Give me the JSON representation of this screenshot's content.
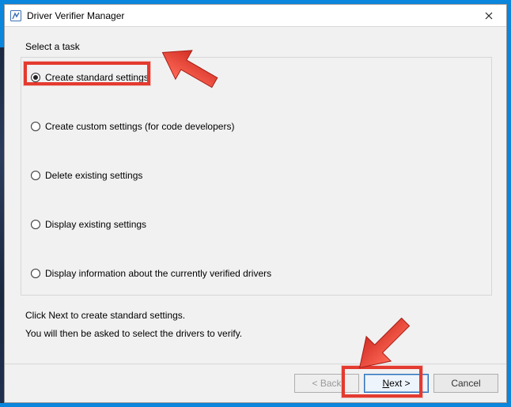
{
  "window": {
    "title": "Driver Verifier Manager",
    "icon_name": "verifier-icon"
  },
  "task_label": "Select a task",
  "options": {
    "opt0": "Create standard settings",
    "opt1": "Create custom settings (for code developers)",
    "opt2": "Delete existing settings",
    "opt3": "Display existing settings",
    "opt4": "Display information about the currently verified drivers"
  },
  "selected_option": 0,
  "hint_line1": "Click Next to create standard settings.",
  "hint_line2": "You will then be asked to select the drivers to verify.",
  "buttons": {
    "back": "< Back",
    "next_prefix": "N",
    "next_suffix": "ext >",
    "cancel": "Cancel"
  },
  "annotation": {
    "color": "#e43a2f"
  }
}
